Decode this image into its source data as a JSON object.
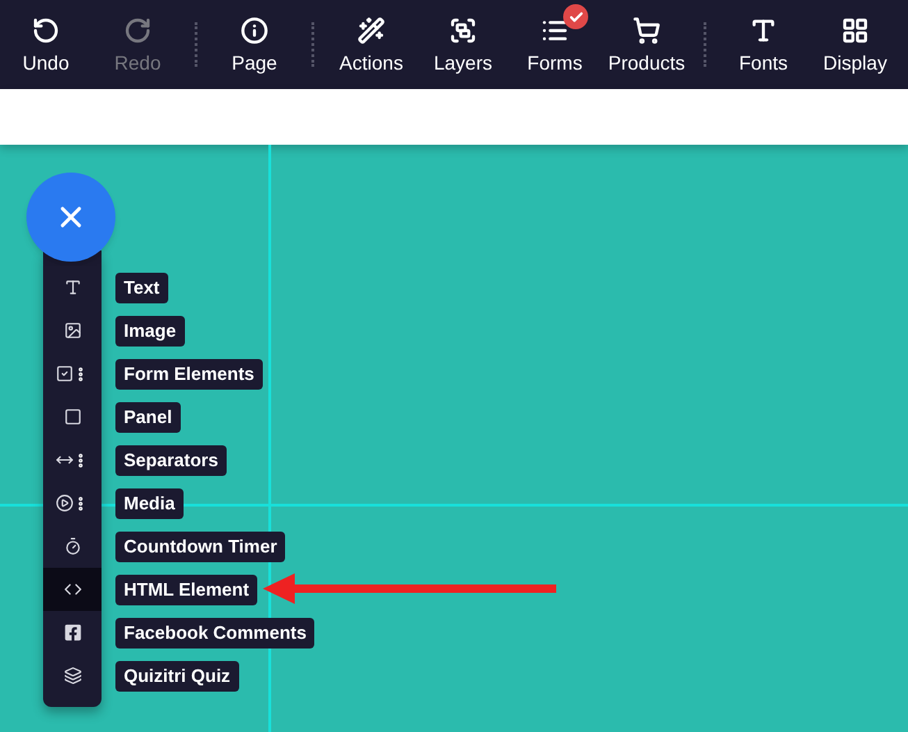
{
  "toolbar": [
    {
      "kind": "button",
      "label": "Undo",
      "disabled": false
    },
    {
      "kind": "button",
      "label": "Redo",
      "disabled": true
    },
    {
      "kind": "separator"
    },
    {
      "kind": "button",
      "label": "Page",
      "disabled": false
    },
    {
      "kind": "separator"
    },
    {
      "kind": "button",
      "label": "Actions",
      "disabled": false
    },
    {
      "kind": "button",
      "label": "Layers",
      "disabled": false
    },
    {
      "kind": "button",
      "label": "Forms",
      "disabled": false,
      "badge": true
    },
    {
      "kind": "button",
      "label": "Products",
      "disabled": false
    },
    {
      "kind": "separator"
    },
    {
      "kind": "button",
      "label": "Fonts",
      "disabled": false
    },
    {
      "kind": "button",
      "label": "Display",
      "disabled": false
    }
  ],
  "add_menu": {
    "open": true,
    "items": [
      {
        "label": "Text",
        "more": false,
        "selected": false,
        "arrow": false
      },
      {
        "label": "Image",
        "more": false,
        "selected": false,
        "arrow": false
      },
      {
        "label": "Form Elements",
        "more": true,
        "selected": false,
        "arrow": false
      },
      {
        "label": "Panel",
        "more": false,
        "selected": false,
        "arrow": false
      },
      {
        "label": "Separators",
        "more": true,
        "selected": false,
        "arrow": false
      },
      {
        "label": "Media",
        "more": true,
        "selected": false,
        "arrow": false
      },
      {
        "label": "Countdown Timer",
        "more": false,
        "selected": false,
        "arrow": false
      },
      {
        "label": "HTML Element",
        "more": false,
        "selected": true,
        "arrow": true
      },
      {
        "label": "Facebook Comments",
        "more": false,
        "selected": false,
        "arrow": false
      },
      {
        "label": "Quizitri Quiz",
        "more": false,
        "selected": false,
        "arrow": false
      }
    ]
  }
}
